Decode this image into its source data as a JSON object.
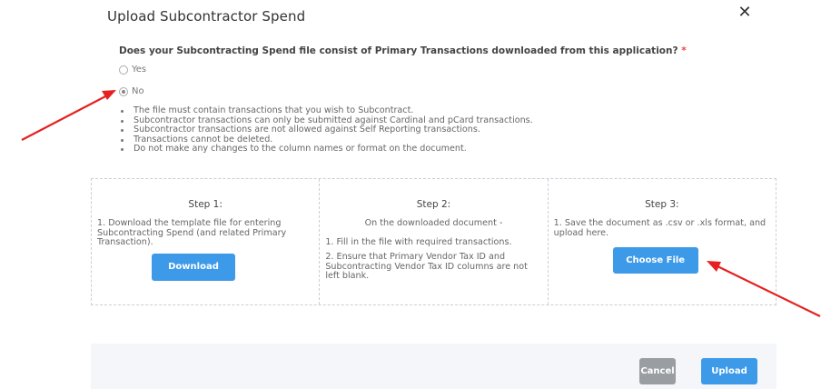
{
  "dialog": {
    "title": "Upload Subcontractor Spend",
    "close_label": "✕"
  },
  "question": {
    "text": "Does your Subcontracting Spend file consist of Primary Transactions downloaded from this application?",
    "required_mark": "*",
    "options": [
      {
        "label": "Yes",
        "checked": false
      },
      {
        "label": "No",
        "checked": true
      }
    ]
  },
  "notes": [
    "The file must contain transactions that you wish to Subcontract.",
    "Subcontractor transactions can only be submitted against Cardinal and pCard transactions.",
    "Subcontractor transactions are not allowed against Self Reporting transactions.",
    "Transactions cannot be deleted.",
    "Do not make any changes to the column names or format on the document."
  ],
  "steps": [
    {
      "title": "Step 1:",
      "lines": [
        "1. Download the template file for entering Subcontracting Spend (and related Primary Transaction)."
      ],
      "button": "Download"
    },
    {
      "title": "Step 2:",
      "subtitle": "On the downloaded document -",
      "lines": [
        "1. Fill in the file with required transactions.",
        "2. Ensure that Primary Vendor Tax ID and Subcontracting Vendor Tax ID columns are not left blank."
      ]
    },
    {
      "title": "Step 3:",
      "lines": [
        "1. Save the document as .csv or .xls format, and upload here."
      ],
      "button": "Choose File"
    }
  ],
  "footer": {
    "cancel_label": "Cancel",
    "upload_label": "Upload"
  },
  "colors": {
    "primary_button": "#3d9ae8",
    "cancel_button": "#9a9ea3",
    "annotation_arrow": "#e62020"
  }
}
